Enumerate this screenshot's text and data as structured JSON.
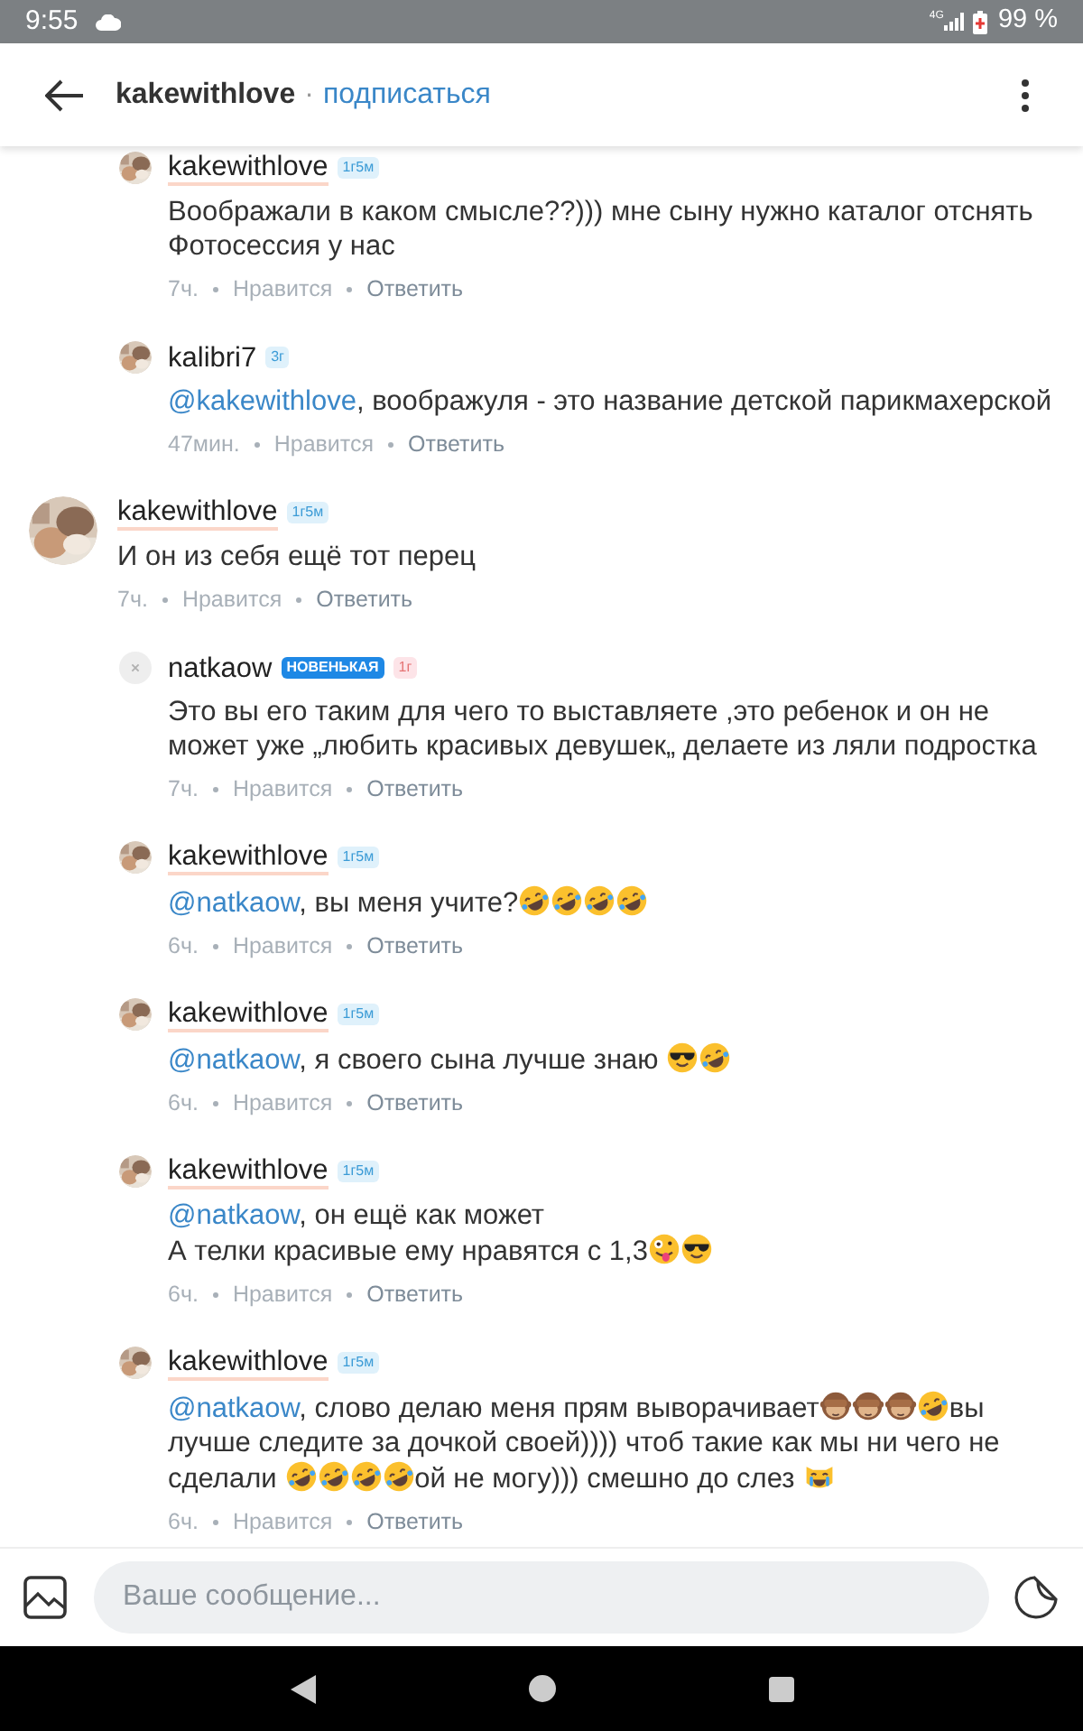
{
  "status_bar": {
    "time": "9:55",
    "network": "4G",
    "battery": "99 %"
  },
  "header": {
    "title": "kakewithlove",
    "separator": "·",
    "action": "подписаться"
  },
  "earlier_replies": [
    {
      "user": "kakewithlove",
      "is_author": true,
      "avatar": {
        "kind": "picture"
      },
      "badges": [
        {
          "kind": "age",
          "text": "1г5м",
          "color": "#dff1fb"
        }
      ],
      "body": [
        {
          "kind": "text",
          "text": "Воображали в каком смысле??))) мне сыну нужно каталог отснять\nФотосессия у нас"
        }
      ],
      "time": "7ч.",
      "like": "Нравится",
      "reply": "Ответить"
    },
    {
      "user": "kalibri7",
      "is_author": false,
      "avatar": {
        "kind": "picture"
      },
      "badges": [
        {
          "kind": "age",
          "text": "3г",
          "color": "#dff1fb"
        }
      ],
      "body": [
        {
          "kind": "mention",
          "text": "@kakewithlove"
        },
        {
          "kind": "text",
          "text": ", воображуля - это название детской парикмахерской"
        }
      ],
      "time": "47мин.",
      "like": "Нравится",
      "reply": "Ответить"
    }
  ],
  "comments": [
    {
      "user": "kakewithlove",
      "is_author": true,
      "avatar": {
        "kind": "picture"
      },
      "badges": [
        {
          "kind": "age",
          "text": "1г5м",
          "color": "#dff1fb"
        }
      ],
      "body": [
        {
          "kind": "text",
          "text": "И он из себя ещё тот перец"
        }
      ],
      "time": "7ч.",
      "like": "Нравится",
      "reply": "Ответить",
      "children": [
        {
          "user": "natkaow",
          "is_author": false,
          "avatar": {
            "kind": "placeholder"
          },
          "badges": [
            {
              "kind": "status",
              "text": "НОВЕНЬКАЯ"
            },
            {
              "kind": "age",
              "text": "1г",
              "color": "#fde4e8"
            }
          ],
          "body": [
            {
              "kind": "text",
              "text": "Это вы его таким для чего то выставляете ,это ребенок и он не может уже „любить красивых девушек„ делаете из ляли подростка"
            }
          ],
          "time": "7ч.",
          "like": "Нравится",
          "reply": "Ответить"
        },
        {
          "user": "kakewithlove",
          "is_author": true,
          "avatar": {
            "kind": "picture"
          },
          "badges": [
            {
              "kind": "age",
              "text": "1г5м",
              "color": "#dff1fb"
            }
          ],
          "body": [
            {
              "kind": "mention",
              "text": "@natkaow"
            },
            {
              "kind": "text",
              "text": ", вы меня учите?"
            },
            {
              "kind": "rofl"
            },
            {
              "kind": "rofl"
            },
            {
              "kind": "rofl"
            },
            {
              "kind": "rofl"
            }
          ],
          "time": "6ч.",
          "like": "Нравится",
          "reply": "Ответить"
        },
        {
          "user": "kakewithlove",
          "is_author": true,
          "avatar": {
            "kind": "picture"
          },
          "badges": [
            {
              "kind": "age",
              "text": "1г5м",
              "color": "#dff1fb"
            }
          ],
          "body": [
            {
              "kind": "mention",
              "text": "@natkaow"
            },
            {
              "kind": "text",
              "text": ", я своего сына лучше знаю "
            },
            {
              "kind": "cool"
            },
            {
              "kind": "rofl"
            }
          ],
          "time": "6ч.",
          "like": "Нравится",
          "reply": "Ответить"
        },
        {
          "user": "kakewithlove",
          "is_author": true,
          "avatar": {
            "kind": "picture"
          },
          "badges": [
            {
              "kind": "age",
              "text": "1г5м",
              "color": "#dff1fb"
            }
          ],
          "body": [
            {
              "kind": "mention",
              "text": "@natkaow"
            },
            {
              "kind": "text",
              "text": ", он ещё как может\nА телки красивые ему нравятся с 1,3"
            },
            {
              "kind": "zany"
            },
            {
              "kind": "cool"
            }
          ],
          "time": "6ч.",
          "like": "Нравится",
          "reply": "Ответить"
        },
        {
          "user": "kakewithlove",
          "is_author": true,
          "avatar": {
            "kind": "picture"
          },
          "badges": [
            {
              "kind": "age",
              "text": "1г5м",
              "color": "#dff1fb"
            }
          ],
          "body": [
            {
              "kind": "mention",
              "text": "@natkaow"
            },
            {
              "kind": "text",
              "text": ", слово делаю меня прям выворачивает"
            },
            {
              "kind": "monkey"
            },
            {
              "kind": "monkey"
            },
            {
              "kind": "monkey"
            },
            {
              "kind": "rofl"
            },
            {
              "kind": "text",
              "text": "вы лучше следите за дочкой своей)))) чтоб такие как мы ни чего не сделали "
            },
            {
              "kind": "rofl"
            },
            {
              "kind": "rofl"
            },
            {
              "kind": "rofl"
            },
            {
              "kind": "rofl"
            },
            {
              "kind": "text",
              "text": "ой не могу))) смешно до слез "
            },
            {
              "kind": "cat"
            }
          ],
          "time": "6ч.",
          "like": "Нравится",
          "reply": "Ответить"
        }
      ]
    }
  ],
  "composer": {
    "placeholder": "Ваше сообщение..."
  }
}
